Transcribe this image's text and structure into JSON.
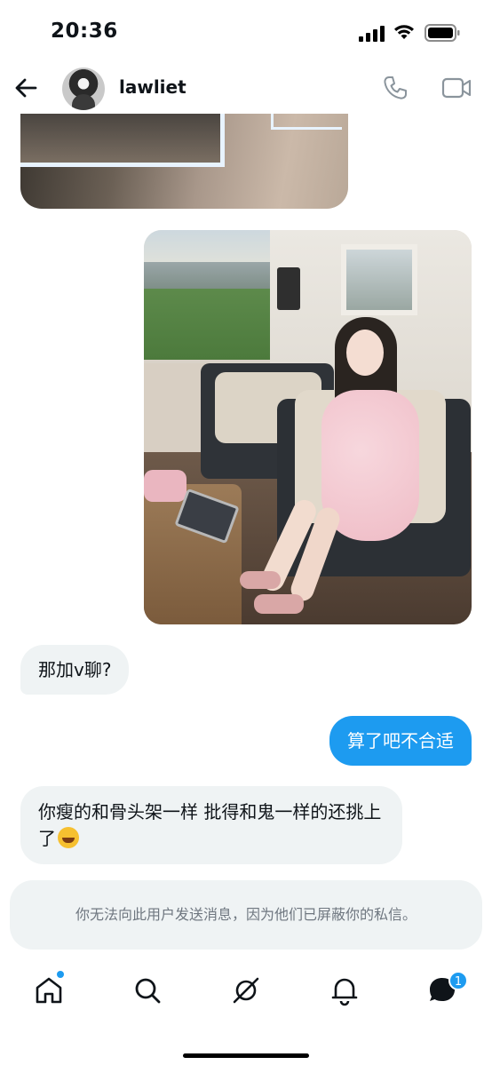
{
  "status_bar": {
    "time": "20:36"
  },
  "header": {
    "username": "lawliet"
  },
  "messages": [
    {
      "direction": "incoming",
      "type": "image",
      "description_icon": "photo"
    },
    {
      "direction": "outgoing",
      "type": "image",
      "description_icon": "photo"
    },
    {
      "direction": "incoming",
      "type": "text",
      "text": "那加v聊?"
    },
    {
      "direction": "outgoing",
      "type": "text",
      "text": "算了吧不合适"
    },
    {
      "direction": "incoming",
      "type": "text",
      "text": "你瘦的和骨头架一样 批得和鬼一样的还挑上了",
      "emoji": "rolling-on-floor-laughing"
    }
  ],
  "blocked_notice": "你无法向此用户发送消息，因为他们已屏蔽你的私信。",
  "bottom_nav": {
    "items": [
      "home",
      "search",
      "grok",
      "notifications",
      "messages"
    ],
    "messages_badge": "1"
  },
  "colors": {
    "accent": "#1d9bf0",
    "incoming_bubble": "#eff3f4",
    "text": "#0f1419"
  }
}
